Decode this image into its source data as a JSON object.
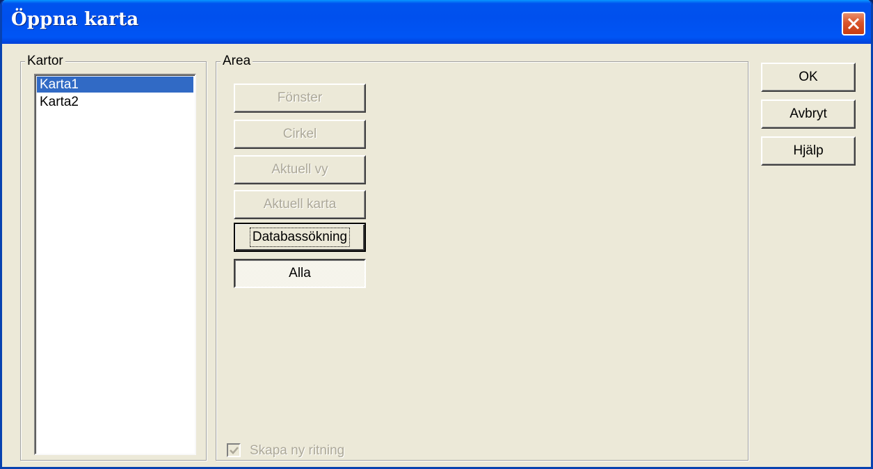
{
  "window": {
    "title": "Öppna karta"
  },
  "maps_group": {
    "label": "Kartor",
    "items": [
      {
        "label": "Karta1",
        "selected": true
      },
      {
        "label": "Karta2",
        "selected": false
      }
    ]
  },
  "area_group": {
    "label": "Area",
    "buttons": {
      "window": "Fönster",
      "circle": "Cirkel",
      "current_view": "Aktuell vy",
      "current_map": "Aktuell karta",
      "database_search": "Databassökning",
      "all": "Alla"
    },
    "new_drawing_checkbox": {
      "label": "Skapa ny ritning",
      "checked": true,
      "enabled": false
    }
  },
  "actions": {
    "ok": "OK",
    "cancel": "Avbryt",
    "help": "Hjälp"
  },
  "colors": {
    "titlebar": "#0054e3",
    "dialog_bg": "#ece9d8",
    "selection": "#316ac5",
    "disabled_text": "#aca899",
    "close_button": "#d9542a"
  }
}
